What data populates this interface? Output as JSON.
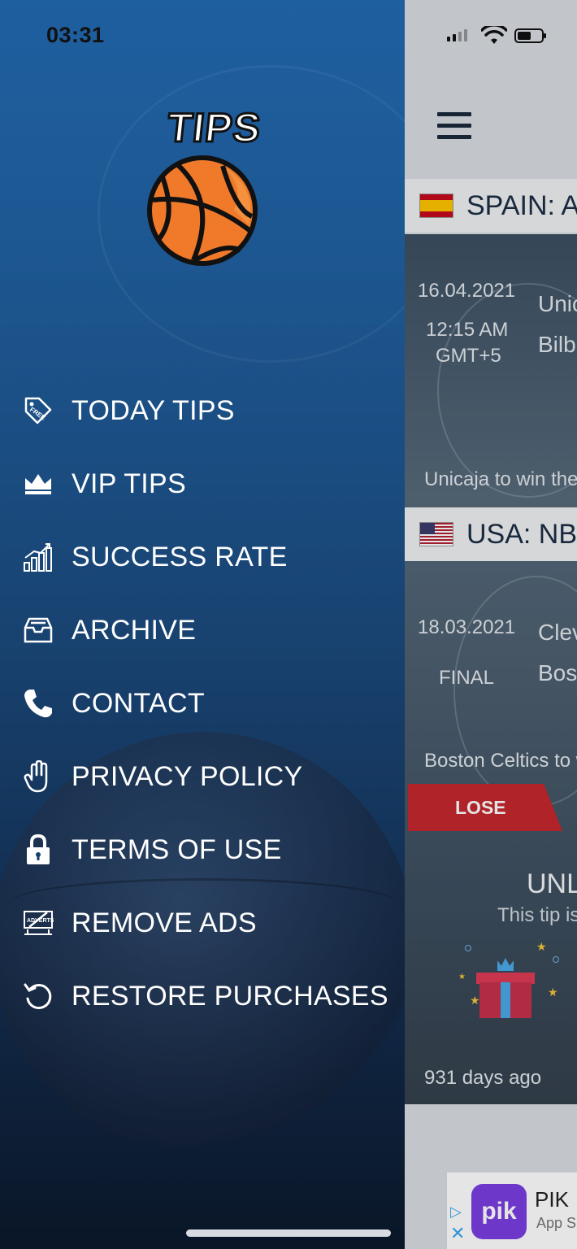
{
  "status_bar": {
    "time": "03:31"
  },
  "drawer": {
    "logo_text": "TIPS",
    "menu": [
      {
        "label": "TODAY TIPS",
        "icon": "free-tag-icon"
      },
      {
        "label": "VIP TIPS",
        "icon": "crown-icon"
      },
      {
        "label": "SUCCESS RATE",
        "icon": "bar-chart-icon"
      },
      {
        "label": "ARCHIVE",
        "icon": "archive-box-icon"
      },
      {
        "label": "CONTACT",
        "icon": "phone-icon"
      },
      {
        "label": "PRIVACY POLICY",
        "icon": "hand-icon"
      },
      {
        "label": "TERMS OF USE",
        "icon": "lock-icon"
      },
      {
        "label": "REMOVE ADS",
        "icon": "no-adverts-icon"
      },
      {
        "label": "RESTORE PURCHASES",
        "icon": "restore-icon"
      }
    ]
  },
  "main": {
    "sections": [
      {
        "league": "SPAIN: AC",
        "date": "16.04.2021",
        "time": "12:15 AM",
        "tz": "GMT+5",
        "team1": "Unic",
        "team2": "Bilba",
        "tip": "Unicaja to win the"
      },
      {
        "league": "USA: NBA",
        "date": "18.03.2021",
        "status": "FINAL",
        "team1": "Clev",
        "team2": "Bost",
        "tip": "Boston Celtics to w",
        "result": "LOSE"
      }
    ],
    "locked": {
      "title": "UNL",
      "subtitle": "This tip is",
      "ago": "931 days ago"
    },
    "ad": {
      "title": "PIK",
      "subtitle": "App S",
      "logo": "pik"
    }
  }
}
